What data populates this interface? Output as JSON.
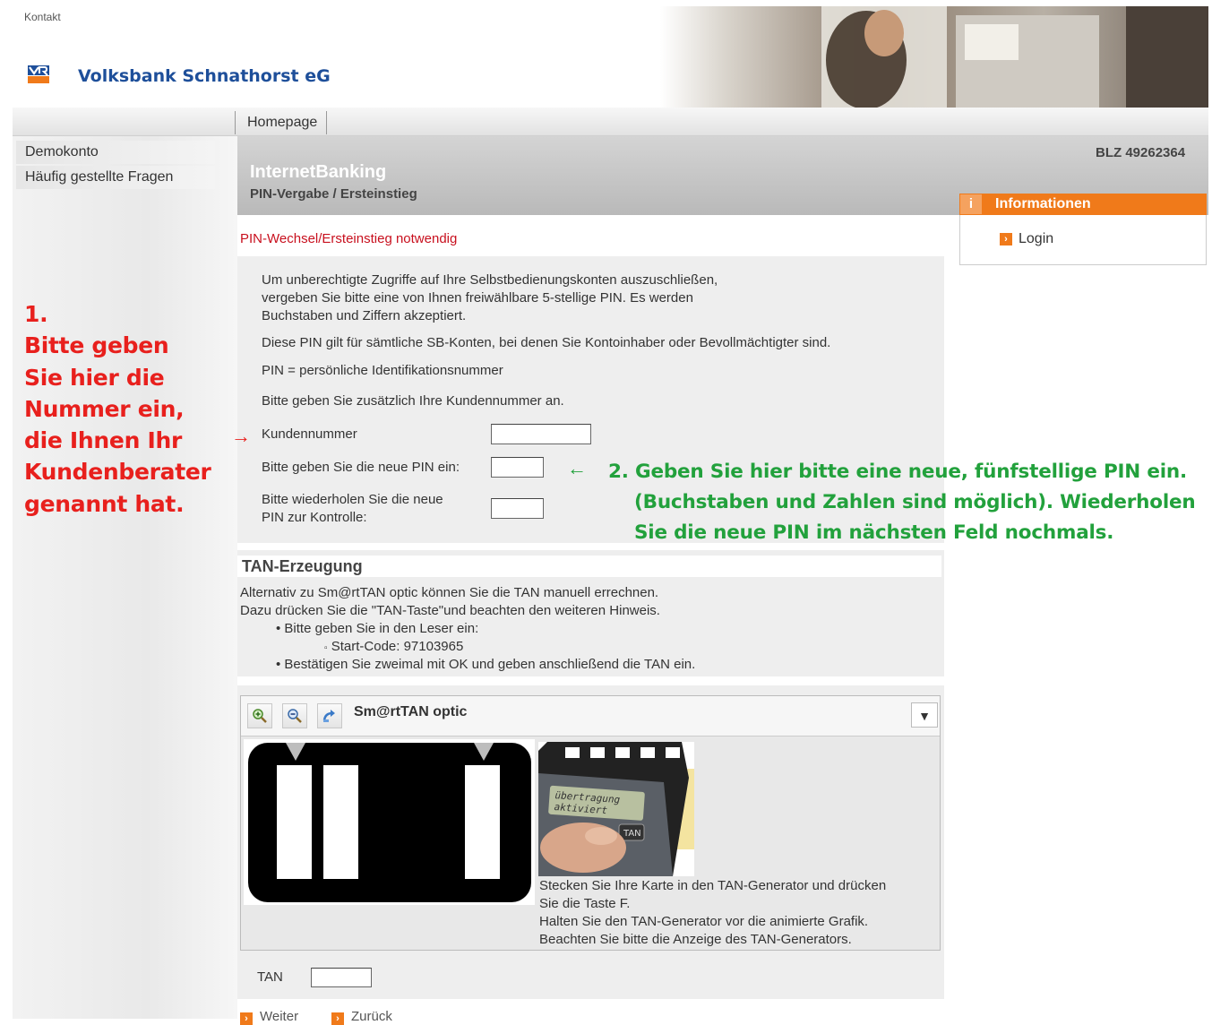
{
  "header": {
    "kontakt_link": "Kontakt",
    "bank_name": "Volksbank Schnathorst eG",
    "logo_icon": "vr-bank-logo-icon",
    "hero_image": "man-opening-fridge-photo"
  },
  "nav": {
    "homepage": "Homepage"
  },
  "sidebar": {
    "items": [
      {
        "label": "Demokonto"
      },
      {
        "label": "Häufig gestellte Fragen"
      }
    ]
  },
  "annotation_1": {
    "lines": [
      "1.",
      "Bitte geben",
      "Sie hier die",
      "Nummer ein,",
      "die Ihnen Ihr",
      "Kundenberater",
      "genannt hat."
    ],
    "arrow": "→",
    "color": "#e8201d"
  },
  "title_band": {
    "blz": "BLZ 49262364",
    "title": "InternetBanking",
    "subtitle": "PIN-Vergabe / Ersteinstieg"
  },
  "info_box": {
    "icon": "i",
    "title": "Informationen",
    "link": "Login",
    "accent": "#f07a1a"
  },
  "pin_section": {
    "heading": "PIN-Wechsel/Ersteinstieg notwendig",
    "intro_lines": [
      "Um unberechtigte Zugriffe auf Ihre Selbstbedienungskonten auszuschließen,",
      "vergeben Sie bitte eine von Ihnen freiwählbare 5-stellige PIN. Es werden",
      "Buchstaben und Ziffern akzeptiert."
    ],
    "para2": "Diese PIN gilt für sämtliche SB-Konten, bei denen Sie Kontoinhaber oder Bevollmächtigter sind.",
    "para3": "PIN = persönliche Identifikationsnummer",
    "para4": "Bitte geben Sie zusätzlich Ihre Kundennummer an.",
    "fields": {
      "kundennummer": {
        "label": "Kundennummer",
        "value": ""
      },
      "new_pin": {
        "label": "Bitte geben Sie die neue PIN ein:",
        "value": ""
      },
      "repeat_pin": {
        "label_line1": "Bitte wiederholen Sie die neue",
        "label_line2": "PIN zur Kontrolle:",
        "value": ""
      }
    }
  },
  "annotation_2": {
    "arrow": "←",
    "line1": "2. Geben Sie hier bitte eine neue, fünfstellige PIN ein.",
    "line2": "(Buchstaben und Zahlen sind möglich). Wiederholen",
    "line3": "Sie die neue PIN im nächsten Feld nochmals.",
    "color": "#22a13c"
  },
  "tan_section": {
    "heading": "TAN-Erzeugung",
    "line1": "Alternativ zu Sm@rtTAN optic können Sie die TAN manuell errechnen.",
    "line2": "Dazu drücken Sie die \"TAN-Taste\"und beachten den weiteren Hinweis.",
    "bullet1": "Bitte geben Sie in den Leser ein:",
    "sub_bullet": "Start-Code: 97103965",
    "bullet2": "Bestätigen Sie zweimal mit OK und geben anschließend die TAN ein."
  },
  "smarttan": {
    "tools": [
      {
        "name": "zoom-in-icon",
        "glyph": "🔍"
      },
      {
        "name": "zoom-out-icon",
        "glyph": "🔍"
      },
      {
        "name": "rotate-icon",
        "glyph": "↶"
      }
    ],
    "title": "Sm@rtTAN optic",
    "dropdown_icon": "▼",
    "device_screen_line1": "übertragung",
    "device_screen_line2": "aktiviert",
    "description_lines": [
      "Stecken Sie Ihre Karte in den TAN-Generator und drücken",
      "Sie die Taste F.",
      "Halten Sie den TAN-Generator vor die animierte Grafik.",
      "Beachten Sie bitte die Anzeige des TAN-Generators."
    ]
  },
  "tan_input": {
    "label": "TAN",
    "value": ""
  },
  "actions": {
    "weiter": "Weiter",
    "zurueck": "Zurück"
  }
}
